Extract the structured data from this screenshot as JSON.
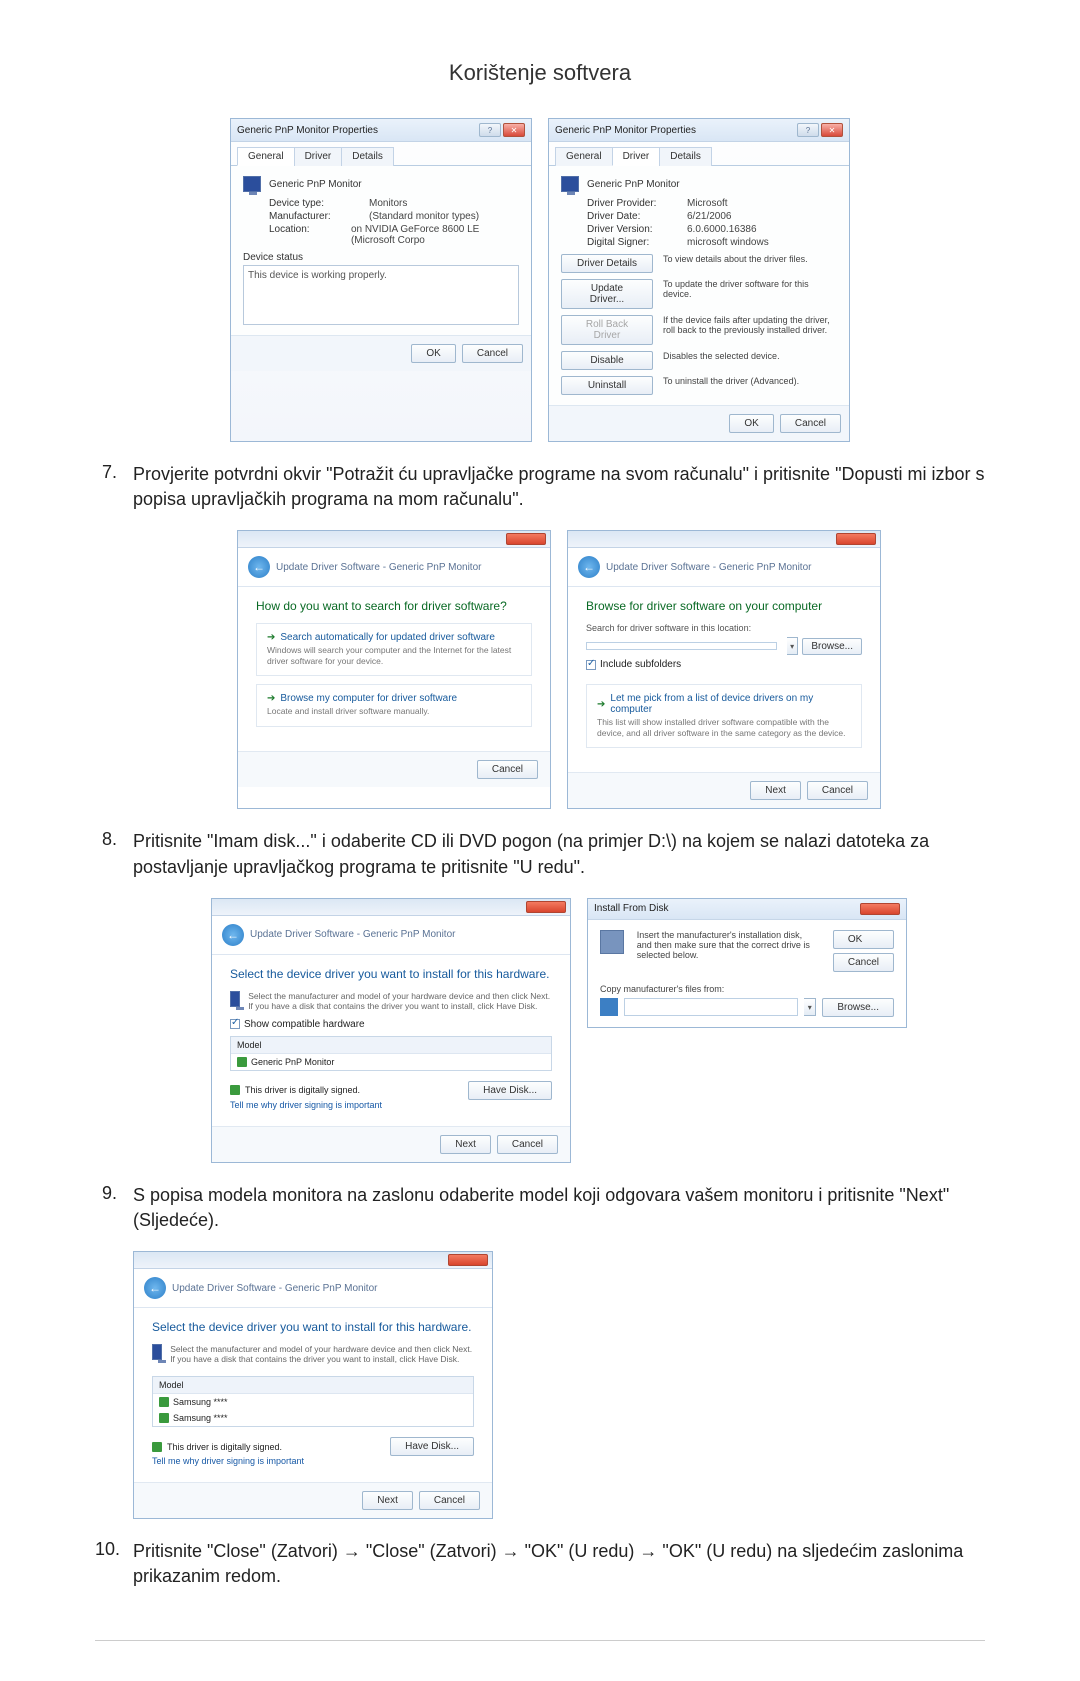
{
  "heading": "Korištenje softvera",
  "d1": {
    "title": "Generic PnP Monitor Properties",
    "tabs": [
      "General",
      "Driver",
      "Details"
    ],
    "name": "Generic PnP Monitor",
    "dt": {
      "k": "Device type:",
      "v": "Monitors"
    },
    "mf": {
      "k": "Manufacturer:",
      "v": "(Standard monitor types)"
    },
    "lc": {
      "k": "Location:",
      "v": "on NVIDIA GeForce 8600 LE (Microsoft Corpo"
    },
    "status_lbl": "Device status",
    "status_txt": "This device is working properly.",
    "ok": "OK",
    "cancel": "Cancel"
  },
  "d2": {
    "title": "Generic PnP Monitor Properties",
    "tabs": [
      "General",
      "Driver",
      "Details"
    ],
    "name": "Generic PnP Monitor",
    "dp": {
      "k": "Driver Provider:",
      "v": "Microsoft"
    },
    "dd": {
      "k": "Driver Date:",
      "v": "6/21/2006"
    },
    "dv": {
      "k": "Driver Version:",
      "v": "6.0.6000.16386"
    },
    "ds": {
      "k": "Digital Signer:",
      "v": "microsoft windows"
    },
    "b1": {
      "l": "Driver Details",
      "d": "To view details about the driver files."
    },
    "b2": {
      "l": "Update Driver...",
      "d": "To update the driver software for this device."
    },
    "b3": {
      "l": "Roll Back Driver",
      "d": "If the device fails after updating the driver, roll back to the previously installed driver."
    },
    "b4": {
      "l": "Disable",
      "d": "Disables the selected device."
    },
    "b5": {
      "l": "Uninstall",
      "d": "To uninstall the driver (Advanced)."
    },
    "ok": "OK",
    "cancel": "Cancel"
  },
  "step7": "Provjerite potvrdni okvir \"Potražit ću upravljačke programe na svom računalu\" i pritisnite \"Dopusti mi izbor s popisa upravljačkih programa na mom računalu\".",
  "w1": {
    "bread": "Update Driver Software - Generic PnP Monitor",
    "q": "How do you want to search for driver software?",
    "o1t": "Search automatically for updated driver software",
    "o1d": "Windows will search your computer and the Internet for the latest driver software for your device.",
    "o2t": "Browse my computer for driver software",
    "o2d": "Locate and install driver software manually.",
    "cancel": "Cancel"
  },
  "w2": {
    "bread": "Update Driver Software - Generic PnP Monitor",
    "q": "Browse for driver software on your computer",
    "loc_lbl": "Search for driver software in this location:",
    "browse": "Browse...",
    "inc": "Include subfolders",
    "o1t": "Let me pick from a list of device drivers on my computer",
    "o1d": "This list will show installed driver software compatible with the device, and all driver software in the same category as the device.",
    "next": "Next",
    "cancel": "Cancel"
  },
  "step8": "Pritisnite \"Imam disk...\" i odaberite CD ili DVD pogon (na primjer D:\\) na kojem se nalazi datoteka za postavljanje upravljačkog programa te pritisnite \"U redu\".",
  "w3": {
    "bread": "Update Driver Software - Generic PnP Monitor",
    "q": "Select the device driver you want to install for this hardware.",
    "d": "Select the manufacturer and model of your hardware device and then click Next. If you have a disk that contains the driver you want to install, click Have Disk.",
    "show": "Show compatible hardware",
    "model_hd": "Model",
    "model_item": "Generic PnP Monitor",
    "signed": "This driver is digitally signed.",
    "tell": "Tell me why driver signing is important",
    "have": "Have Disk...",
    "next": "Next",
    "cancel": "Cancel"
  },
  "inst": {
    "title": "Install From Disk",
    "desc": "Insert the manufacturer's installation disk, and then make sure that the correct drive is selected below.",
    "ok": "OK",
    "cancel": "Cancel",
    "copy": "Copy manufacturer's files from:",
    "browse": "Browse..."
  },
  "step9": "S popisa modela monitora na zaslonu odaberite model koji odgovara vašem monitoru i pritisnite \"Next\" (Sljedeće).",
  "w4": {
    "bread": "Update Driver Software - Generic PnP Monitor",
    "q": "Select the device driver you want to install for this hardware.",
    "d": "Select the manufacturer and model of your hardware device and then click Next. If you have a disk that contains the driver you want to install, click Have Disk.",
    "model_hd": "Model",
    "m1": "Samsung ****",
    "m2": "Samsung ****",
    "signed": "This driver is digitally signed.",
    "tell": "Tell me why driver signing is important",
    "have": "Have Disk...",
    "next": "Next",
    "cancel": "Cancel"
  },
  "step10": "Pritisnite \"Close\" (Zatvori) → \"Close\" (Zatvori) → \"OK\" (U redu) → \"OK\" (U redu) na sljedećim zaslonima prikazanim redom."
}
